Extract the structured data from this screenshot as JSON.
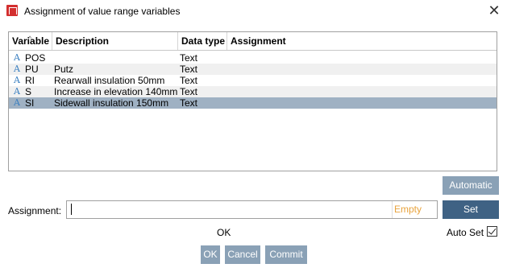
{
  "window": {
    "title": "Assignment of value range variables",
    "close_symbol": "✕"
  },
  "table": {
    "columns": [
      "Variable",
      "Description",
      "Data type",
      "Assignment"
    ],
    "rows": [
      {
        "variable": "POS",
        "description": "",
        "data_type": "Text",
        "assignment": "",
        "icon": "A"
      },
      {
        "variable": "PU",
        "description": "Putz",
        "data_type": "Text",
        "assignment": "",
        "icon": "A"
      },
      {
        "variable": "RI",
        "description": "Rearwall insulation 50mm",
        "data_type": "Text",
        "assignment": "",
        "icon": "A"
      },
      {
        "variable": "S",
        "description": "Increase in elevation 140mm",
        "data_type": "Text",
        "assignment": "",
        "icon": "A"
      },
      {
        "variable": "SI",
        "description": "Sidewall insulation 150mm",
        "data_type": "Text",
        "assignment": "",
        "icon": "A"
      }
    ],
    "selected_row": 4
  },
  "buttons": {
    "automatic": "Automatic",
    "set": "Set",
    "ok": "OK",
    "cancel": "Cancel",
    "commit": "Commit"
  },
  "assignment": {
    "label": "Assignment:",
    "value": "",
    "empty_hint": "Empty"
  },
  "status": {
    "text": "OK"
  },
  "auto_set": {
    "label": "Auto Set",
    "checked": true
  },
  "colors": {
    "accent_button": "#3f6284",
    "light_button": "#8aa1b6",
    "selected_row": "#9fb1c3",
    "empty_hint": "#e8a33d"
  }
}
